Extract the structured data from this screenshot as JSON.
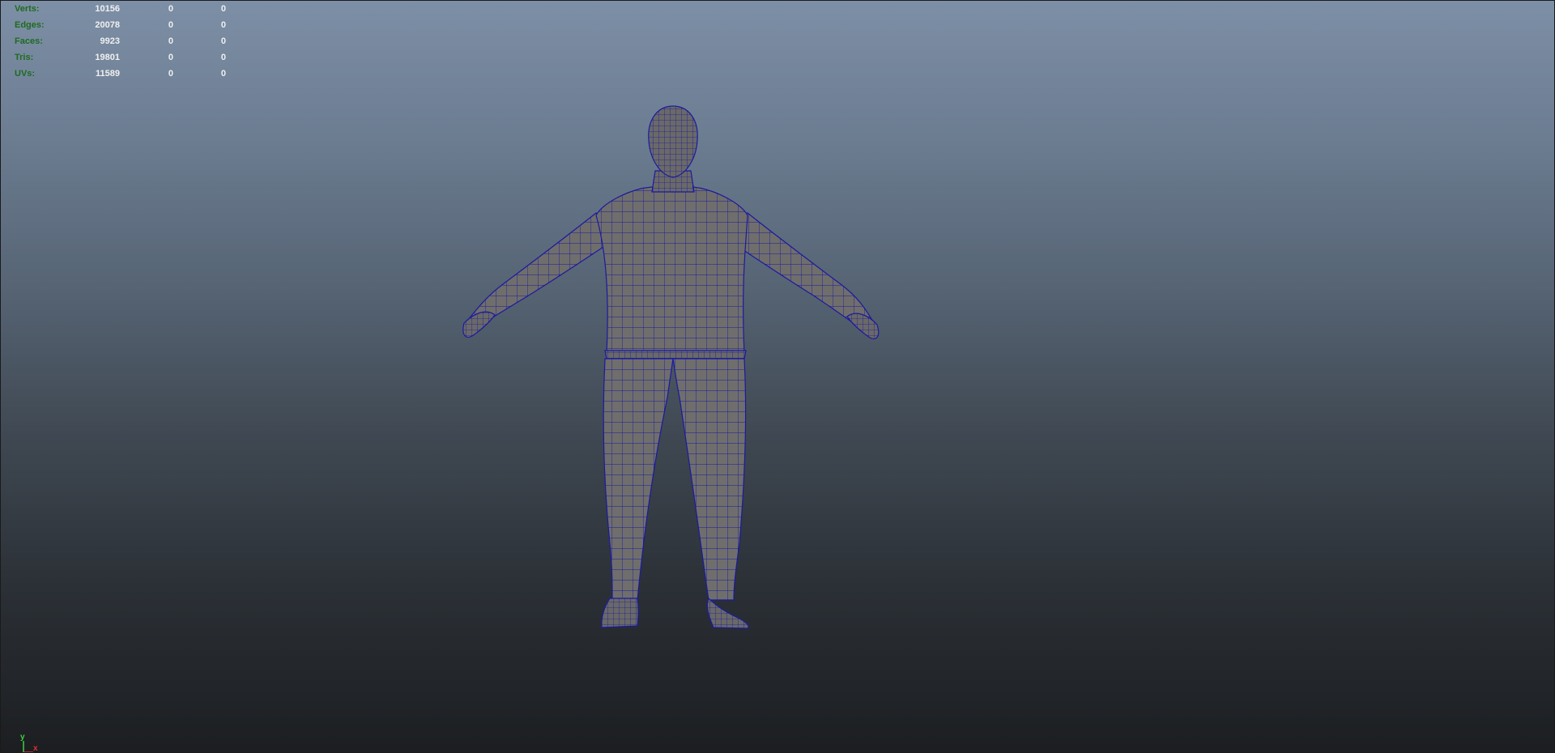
{
  "stats": [
    {
      "label": "Verts:",
      "v1": "10156",
      "v2": "0",
      "v3": "0"
    },
    {
      "label": "Edges:",
      "v1": "20078",
      "v2": "0",
      "v3": "0"
    },
    {
      "label": "Faces:",
      "v1": "9923",
      "v2": "0",
      "v3": "0"
    },
    {
      "label": "Tris:",
      "v1": "19801",
      "v2": "0",
      "v3": "0"
    },
    {
      "label": "UVs:",
      "v1": "11589",
      "v2": "0",
      "v3": "0"
    }
  ],
  "axis": {
    "y_label": "y",
    "x_label": "x"
  },
  "colors": {
    "wire": "#1a1aa0",
    "mesh_fill": "#6f6e6c",
    "hud_label": "#1e6b1e"
  },
  "icons": {
    "axis": "axis-gizmo-icon",
    "model": "wireframe-human-mesh"
  }
}
